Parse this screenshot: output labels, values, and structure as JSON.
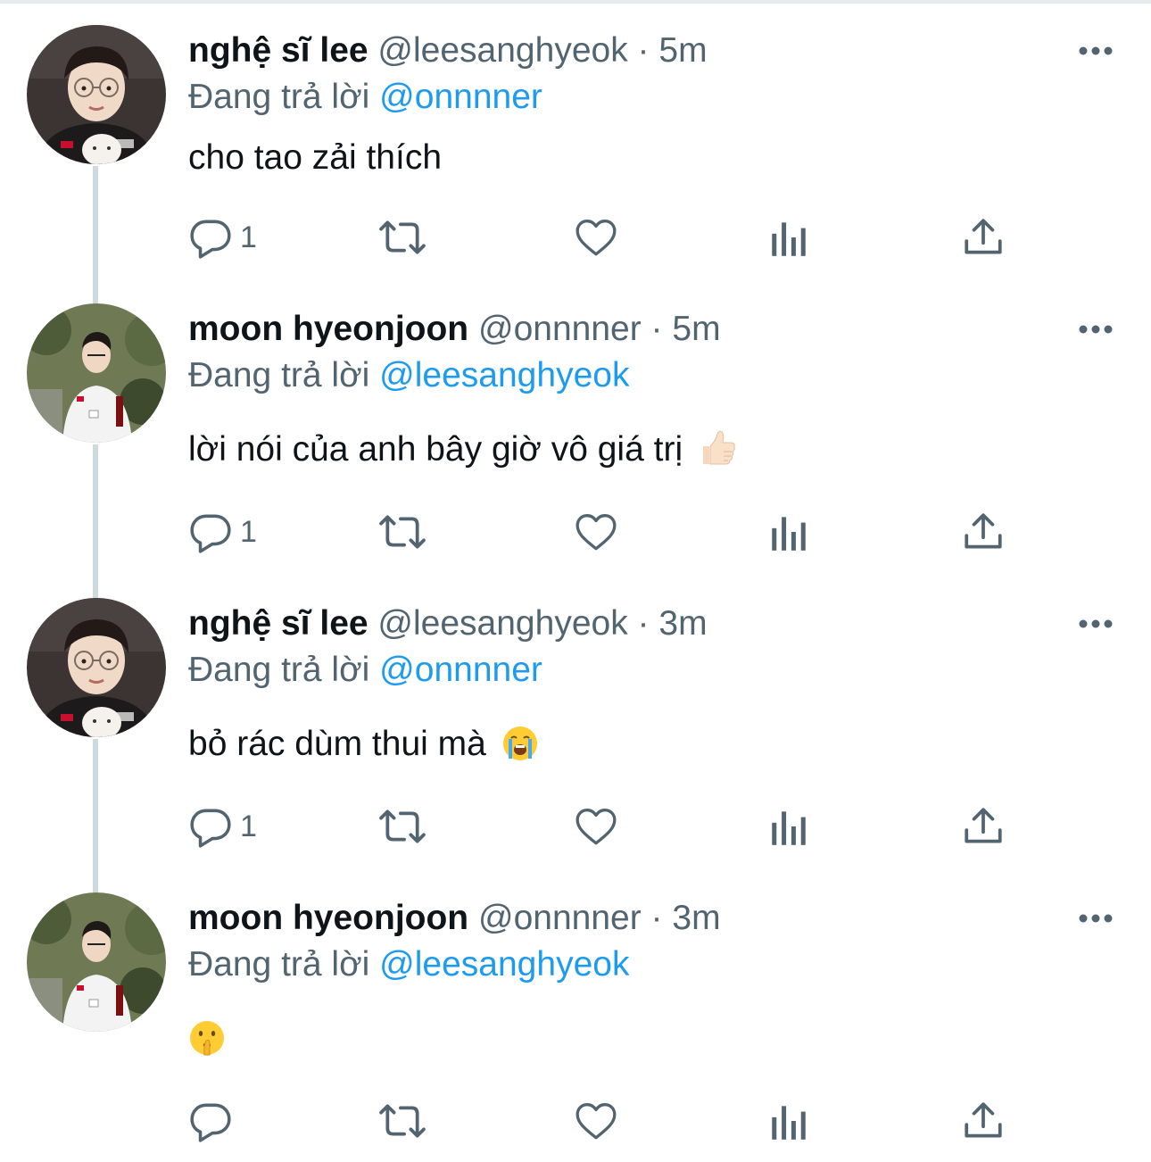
{
  "tweets": [
    {
      "name": "nghệ sĩ lee",
      "handle": "@leesanghyeok",
      "dot": "·",
      "time": "5m",
      "replying_prefix": "Đang trả lời",
      "replying_to": "@onnnner",
      "text": "cho tao zải thích",
      "emoji": "",
      "reply_count": "1"
    },
    {
      "name": "moon hyeonjoon",
      "handle": "@onnnner",
      "dot": "·",
      "time": "5m",
      "replying_prefix": "Đang trả lời",
      "replying_to": "@leesanghyeok",
      "text": "lời nói của anh bây giờ vô giá trị",
      "emoji": "thumbs-up-emoji",
      "reply_count": "1"
    },
    {
      "name": "nghệ sĩ lee",
      "handle": "@leesanghyeok",
      "dot": "·",
      "time": "3m",
      "replying_prefix": "Đang trả lời",
      "replying_to": "@onnnner",
      "text": "bỏ rác dùm thui mà",
      "emoji": "loudly-crying-face-emoji",
      "reply_count": "1"
    },
    {
      "name": "moon hyeonjoon",
      "handle": "@onnnner",
      "dot": "·",
      "time": "3m",
      "replying_prefix": "Đang trả lời",
      "replying_to": "@leesanghyeok",
      "text": "",
      "emoji": "shushing-face-emoji",
      "reply_count": ""
    }
  ],
  "colors": {
    "text": "#0f1419",
    "secondary": "#536471",
    "link": "#1d9bf0",
    "thread_line": "#cfd9de"
  }
}
